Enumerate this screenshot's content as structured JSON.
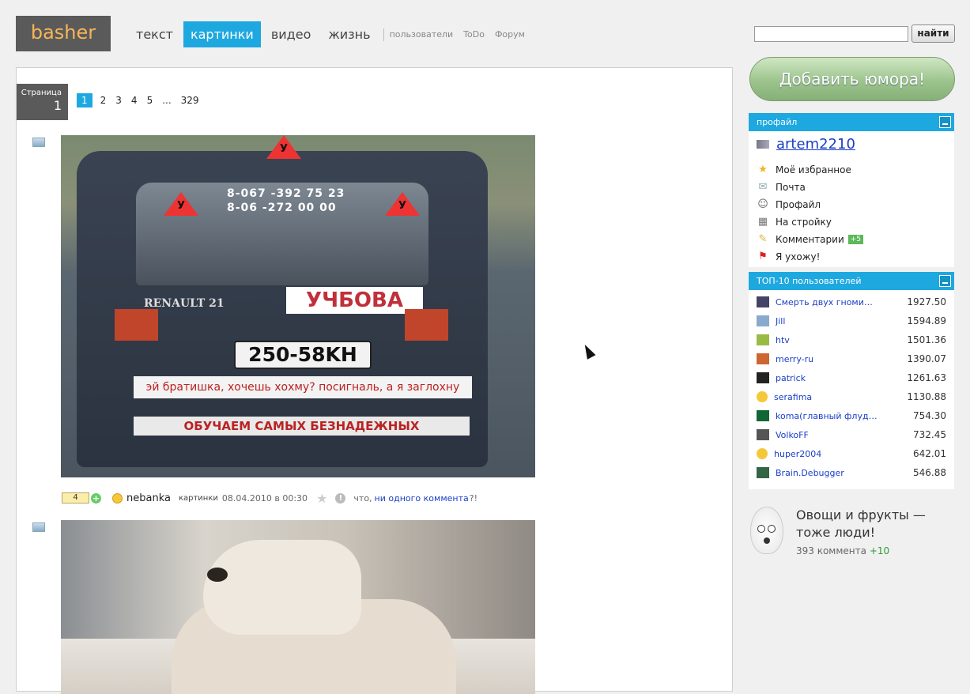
{
  "header": {
    "logo": "basher",
    "tabs": [
      "текст",
      "картинки",
      "видео",
      "жизнь"
    ],
    "active_tab": "картинки",
    "small_links": [
      "пользователи",
      "ToDo",
      "Форум"
    ],
    "search_placeholder": "",
    "search_button": "найти"
  },
  "pager": {
    "label": "Страница",
    "current": "1",
    "pages": [
      "1",
      "2",
      "3",
      "4",
      "5",
      "...",
      "329"
    ]
  },
  "post1": {
    "photo_texts": {
      "plate_sign": "У",
      "phones": [
        "8-067 -392 75 23",
        "8-06  -272 00 00"
      ],
      "brand": "RENAULT 21",
      "banner": "УЧБОВА",
      "plate": "250-58KH",
      "band1": "эй братишка, хочешь хохму? посигналь, а я заглохну",
      "band2": "ОБУЧАЕМ САМЫХ БЕЗНАДЕЖНЫХ"
    },
    "rating": "4",
    "author": "nebanka",
    "category": "картинки",
    "date": "08.04.2010 в 00:30",
    "comment_prefix": "что,",
    "comment_link": "ни одного коммента",
    "comment_suffix": "?!"
  },
  "sidebar": {
    "add_button": "Добавить юмора!",
    "profile": {
      "header": "профайл",
      "username": "artem2210",
      "items": [
        {
          "label": "Моё избранное",
          "icon": "star-icon"
        },
        {
          "label": "Почта",
          "icon": "mail-icon"
        },
        {
          "label": "Профайл",
          "icon": "profile-icon"
        },
        {
          "label": "На стройку",
          "icon": "build-icon"
        },
        {
          "label": "Комментарии",
          "icon": "comments-icon",
          "badge": "+5"
        },
        {
          "label": "Я ухожу!",
          "icon": "exit-icon"
        }
      ]
    },
    "top10": {
      "header": "ТОП-10 пользователей",
      "users": [
        {
          "name": "Смерть двух гноми…",
          "score": "1927.50"
        },
        {
          "name": "Jill",
          "score": "1594.89"
        },
        {
          "name": "htv",
          "score": "1501.36"
        },
        {
          "name": "merry-ru",
          "score": "1390.07"
        },
        {
          "name": "patrick",
          "score": "1261.63"
        },
        {
          "name": "serafima",
          "score": "1130.88"
        },
        {
          "name": "koma(главный флуд…",
          "score": "754.30"
        },
        {
          "name": "VolkoFF",
          "score": "732.45"
        },
        {
          "name": "huper2004",
          "score": "642.01"
        },
        {
          "name": "Brain.Debugger",
          "score": "546.88"
        }
      ]
    },
    "promo": {
      "title": "Овощи и фрукты — тоже люди!",
      "comments": "393 коммента",
      "delta": "+10"
    }
  },
  "colors": {
    "accent": "#1ea8e0",
    "logo_bg": "#5a5a5a",
    "logo_text": "#f7b558",
    "add_button": "#9cc48c"
  }
}
